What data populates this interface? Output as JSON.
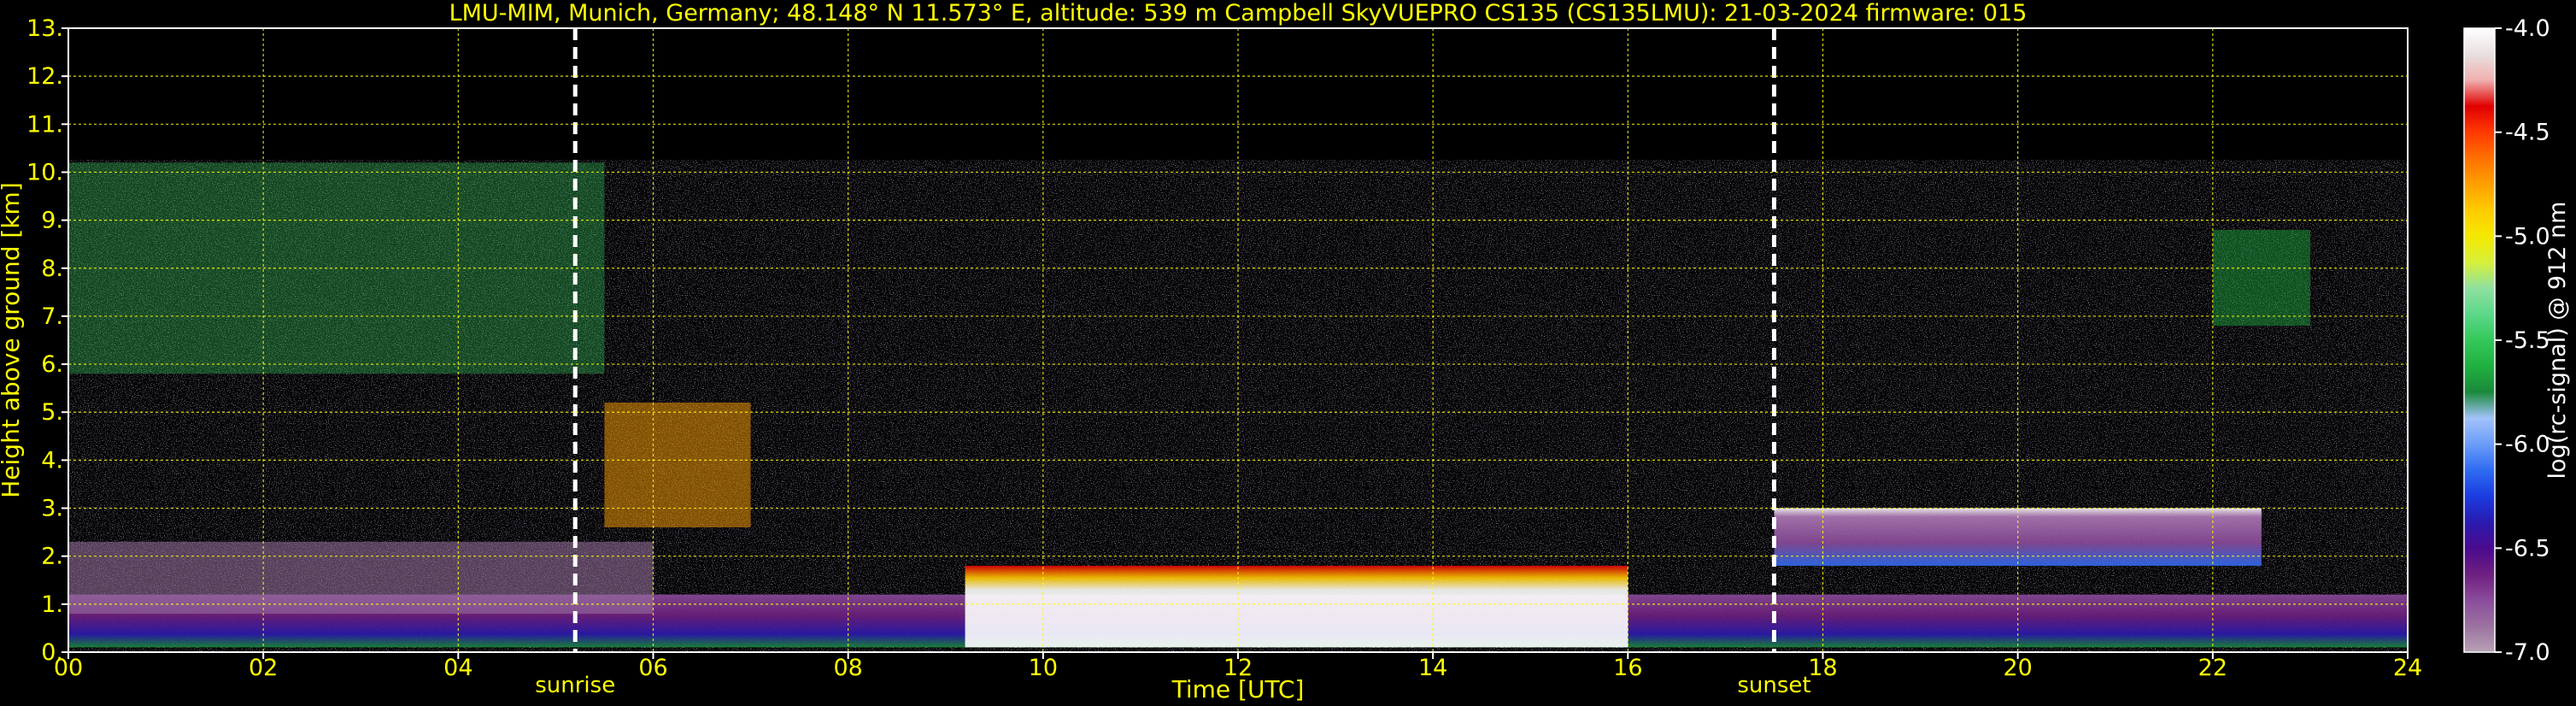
{
  "chart_data": {
    "type": "heatmap",
    "title": "LMU-MIM, Munich, Germany; 48.148° N 11.573° E, altitude: 539 m    Campbell SkyVUEPRO CS135 (CS135LMU): 21-03-2024    firmware: 015",
    "xlabel": "Time [UTC]",
    "ylabel": "Height above ground [km]",
    "xlim": [
      0,
      24
    ],
    "ylim": [
      0,
      13
    ],
    "xticks": [
      "00",
      "02",
      "04",
      "06",
      "08",
      "10",
      "12",
      "14",
      "16",
      "18",
      "20",
      "22",
      "24"
    ],
    "yticks": [
      "0.",
      "1.",
      "2.",
      "3.",
      "4.",
      "5.",
      "6.",
      "7.",
      "8.",
      "9.",
      "10.",
      "11.",
      "12.",
      "13."
    ],
    "grid": true,
    "grid_color": "#ffff00",
    "signal_top_km": 10.25,
    "markers": [
      {
        "label": "sunrise",
        "x": 5.2
      },
      {
        "label": "sunset",
        "x": 17.5
      }
    ],
    "colorbar": {
      "label": "log(rc-signal) @ 912 nm",
      "range": [
        -7.0,
        -4.0
      ],
      "ticks": [
        "-4.0",
        "-4.5",
        "-5.0",
        "-5.5",
        "-6.0",
        "-6.5",
        "-7.0"
      ],
      "colors": [
        "#b8a0b6",
        "#9b72a0",
        "#8b4c9b",
        "#6e1f80",
        "#4a0a8e",
        "#2a1ab0",
        "#1a3ce0",
        "#2f6cf2",
        "#6a9cf8",
        "#a3c2fb",
        "#1a8a3a",
        "#20b040",
        "#34c85a",
        "#5cd88a",
        "#8fe0a0",
        "#d6f03a",
        "#f4e800",
        "#ffcc00",
        "#ff9f00",
        "#ff7000",
        "#ff3a00",
        "#e00000",
        "#f0b0b0",
        "#e8e0e0",
        "#ffffff"
      ]
    },
    "layers": [
      {
        "name": "boundary-layer",
        "x_start": 0,
        "x_end": 24,
        "y_bottom": 0.1,
        "y_top": 1.2
      },
      {
        "name": "residual-layer",
        "x_start": 0,
        "x_end": 6,
        "y_bottom": 0.8,
        "y_top": 2.3
      },
      {
        "name": "convective-clouds",
        "x_start": 9.2,
        "x_end": 16,
        "y_bottom": 0.1,
        "y_top": 1.8
      },
      {
        "name": "elevated-layer",
        "x_start": 17.5,
        "x_end": 22.5,
        "y_bottom": 1.8,
        "y_top": 3.0
      },
      {
        "name": "cirrus-band-1",
        "x_start": 0,
        "x_end": 5.5,
        "y_bottom": 5.8,
        "y_top": 10.2
      },
      {
        "name": "cirrus-band-2",
        "x_start": 5.5,
        "x_end": 7,
        "y_bottom": 2.6,
        "y_top": 5.2
      },
      {
        "name": "cirrus-band-3",
        "x_start": 22,
        "x_end": 23,
        "y_bottom": 6.8,
        "y_top": 8.8
      }
    ]
  }
}
